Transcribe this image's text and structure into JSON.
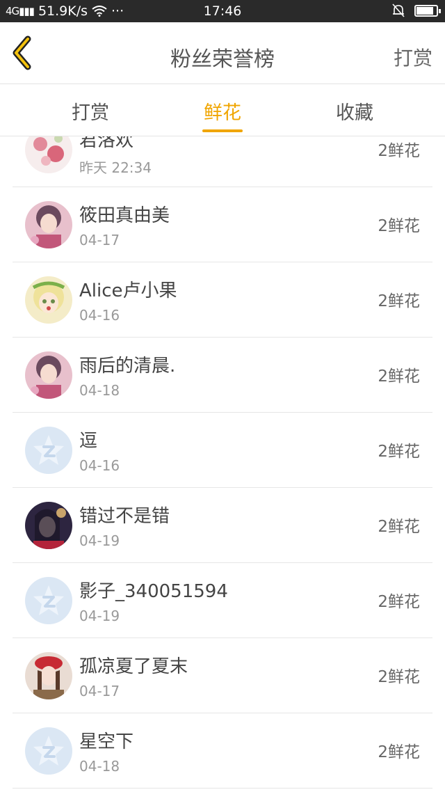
{
  "status_bar": {
    "network": "4G",
    "speed": "51.9K/s",
    "more": "···",
    "time": "17:46",
    "battery_level": 0.85
  },
  "nav": {
    "title": "粉丝荣誉榜",
    "action_label": "打赏"
  },
  "tabs": [
    {
      "label": "打赏",
      "active": false
    },
    {
      "label": "鲜花",
      "active": true
    },
    {
      "label": "收藏",
      "active": false
    }
  ],
  "colors": {
    "accent": "#f0a500",
    "text": "#444444",
    "muted": "#999999",
    "default_avatar_bg": "#dbe7f4"
  },
  "list": [
    {
      "name": "君洛欢",
      "date": "昨天 22:34",
      "amount": "2鲜花",
      "avatar": "floral-avatar"
    },
    {
      "name": "筱田真由美",
      "date": "04-17",
      "amount": "2鲜花",
      "avatar": "anime-girl-avatar"
    },
    {
      "name": "Alice卢小果",
      "date": "04-16",
      "amount": "2鲜花",
      "avatar": "blonde-girl-avatar"
    },
    {
      "name": "雨后的清晨.",
      "date": "04-18",
      "amount": "2鲜花",
      "avatar": "anime-girl-avatar"
    },
    {
      "name": "逗",
      "date": "04-16",
      "amount": "2鲜花",
      "avatar": "default-star-avatar"
    },
    {
      "name": "错过不是错",
      "date": "04-19",
      "amount": "2鲜花",
      "avatar": "dark-hair-avatar"
    },
    {
      "name": "影子_340051594",
      "date": "04-19",
      "amount": "2鲜花",
      "avatar": "default-star-avatar"
    },
    {
      "name": "孤凉夏了夏末",
      "date": "04-17",
      "amount": "2鲜花",
      "avatar": "red-hat-avatar"
    },
    {
      "name": "星空下",
      "date": "04-18",
      "amount": "2鲜花",
      "avatar": "default-star-avatar"
    }
  ]
}
